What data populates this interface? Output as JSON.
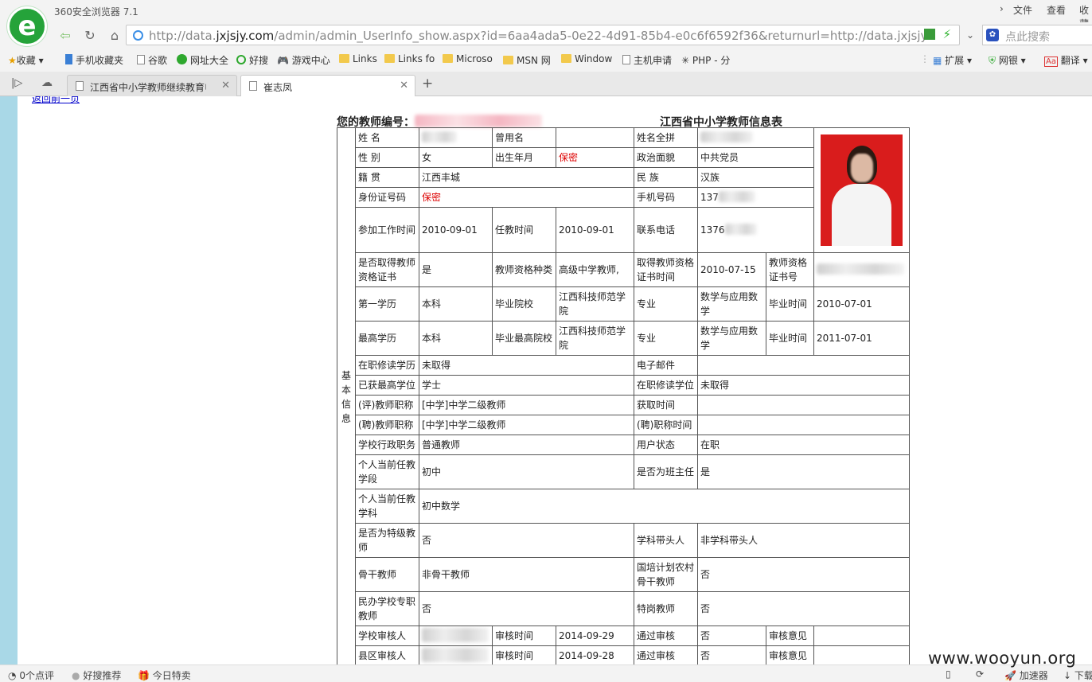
{
  "browser": {
    "title": "360安全浏览器 7.1",
    "menu": [
      "文件",
      "查看",
      "收藏"
    ],
    "url_prefix": "http://data.",
    "url_domain": "jxjsjy.com",
    "url_rest": "/admin/admin_UserInfo_show.aspx?id=6aa4ada5-0e22-4d91-85b4-e0c6f6592f36&returnurl=http://data.jxjsjy.con",
    "search_placeholder": "点此搜索"
  },
  "bookmarks": [
    "收藏",
    "手机收藏夹",
    "谷歌",
    "网址大全",
    "好搜",
    "游戏中心",
    "Links",
    "Links fo",
    "Microso",
    "MSN 网",
    "Window",
    "主机申请",
    "PHP - 分",
    "扩展",
    "网银",
    "翻译"
  ],
  "tabs": [
    {
      "label": "江西省中小学教师继续教育电子"
    },
    {
      "label": "崔志凤"
    }
  ],
  "page": {
    "back_link": "返回前一页",
    "teacher_no_label": "您的教师编号：",
    "title": "江西省中小学教师信息表",
    "side_label": [
      "基",
      "本",
      "信",
      "息"
    ],
    "labels": {
      "name": "姓 名",
      "former_name": "曾用名",
      "pinyin": "姓名全拼",
      "gender": "性 别",
      "birth": "出生年月",
      "political": "政治面貌",
      "native": "籍 贯",
      "ethnic": "民 族",
      "id_no": "身份证号码",
      "mobile": "手机号码",
      "work_start": "参加工作时间",
      "teach_start": "任教时间",
      "phone": "联系电话",
      "cert_has": "是否取得教师资格证书",
      "cert_type": "教师资格种类",
      "cert_time": "取得教师资格证书时间",
      "cert_no": "教师资格证书号",
      "edu1": "第一学历",
      "school1": "毕业院校",
      "major": "专业",
      "grad_time": "毕业时间",
      "edu_top": "最高学历",
      "school_top": "毕业最高院校",
      "study_edu": "在职修读学历",
      "email": "电子邮件",
      "degree": "已获最高学位",
      "study_degree": "在职修读学位",
      "title_eval": "(评)教师职称",
      "title_eval_time": "获取时间",
      "title_hire": "(聘)教师职称",
      "title_hire_time": "(聘)职称时间",
      "admin_post": "学校行政职务",
      "user_status": "用户状态",
      "stage": "个人当前任教学段",
      "head_teacher": "是否为班主任",
      "subject": "个人当前任教学科",
      "special": "是否为特级教师",
      "leader": "学科带头人",
      "backbone": "骨干教师",
      "national": "国培计划农村骨干教师",
      "private": "民办学校专职教师",
      "special_post": "特岗教师",
      "school_reviewer": "学校审核人",
      "review_time": "审核时间",
      "pass": "通过审核",
      "opinion": "审核意见",
      "county_reviewer": "县区审核人"
    },
    "values": {
      "gender": "女",
      "birth": "保密",
      "political": "中共党员",
      "native": "江西丰城",
      "ethnic": "汉族",
      "id_no": "保密",
      "mobile": "137",
      "phone": "1376",
      "work_start": "2010-09-01",
      "teach_start": "2010-09-01",
      "cert_has": "是",
      "cert_type": "高级中学教师,",
      "cert_time": "2010-07-15",
      "edu1": "本科",
      "school1": "江西科技师范学院",
      "major": "数学与应用数学",
      "grad_time1": "2010-07-01",
      "edu_top": "本科",
      "school_top": "江西科技师范学院",
      "major_top": "数学与应用数学",
      "grad_time_top": "2011-07-01",
      "study_edu": "未取得",
      "degree": "学士",
      "study_degree": "未取得",
      "title_eval": "[中学]中学二级教师",
      "title_hire": "[中学]中学二级教师",
      "admin_post": "普通教师",
      "user_status": "在职",
      "stage": "初中",
      "head_teacher": "是",
      "subject": "初中数学",
      "special": "否",
      "leader": "非学科带头人",
      "backbone": "非骨干教师",
      "national": "否",
      "private": "否",
      "special_post": "否",
      "school_review_time": "2014-09-29",
      "school_pass": "否",
      "county_review_time": "2014-09-28",
      "county_pass": "否"
    }
  },
  "statusbar": {
    "comments": "0个点评",
    "recommend": "好搜推荐",
    "deals": "今日特卖",
    "accel": "加速器",
    "download": "下载"
  },
  "watermark": "www.wooyun.org"
}
